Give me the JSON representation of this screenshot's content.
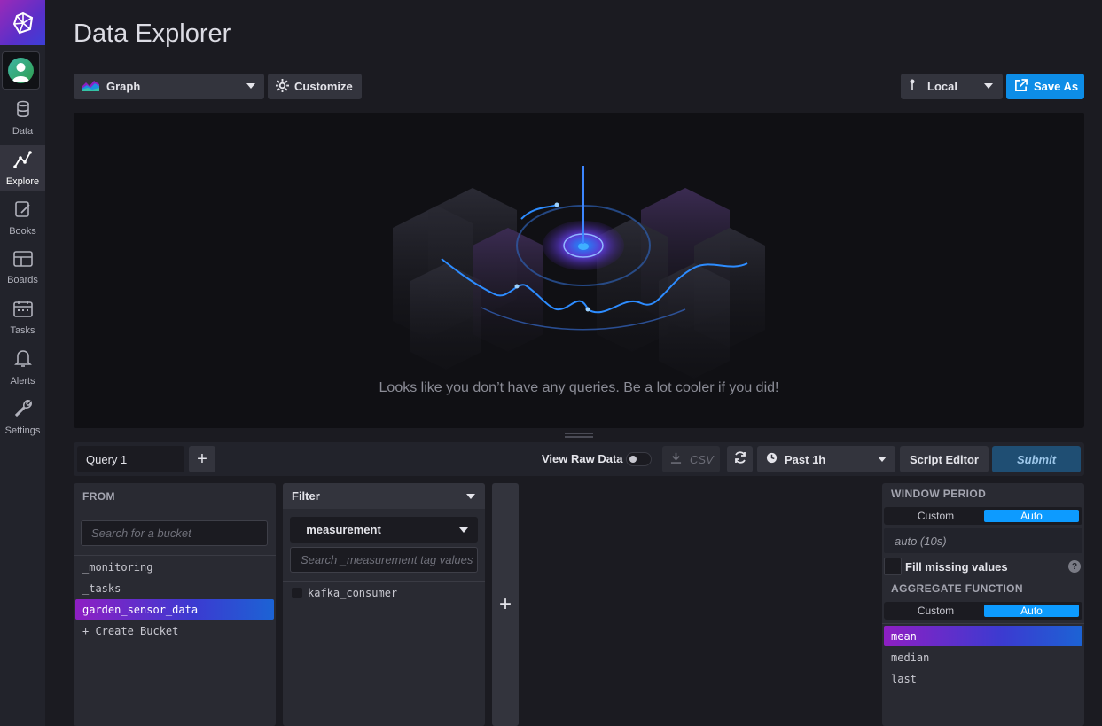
{
  "page": {
    "title": "Data Explorer"
  },
  "sidebar": {
    "items": [
      {
        "label": "Data",
        "icon": "database-icon"
      },
      {
        "label": "Explore",
        "icon": "explore-graph-icon",
        "active": true
      },
      {
        "label": "Books",
        "icon": "notebook-icon"
      },
      {
        "label": "Boards",
        "icon": "dashboard-grid-icon"
      },
      {
        "label": "Tasks",
        "icon": "calendar-icon"
      },
      {
        "label": "Alerts",
        "icon": "bell-icon"
      },
      {
        "label": "Settings",
        "icon": "wrench-icon"
      }
    ]
  },
  "toolbar": {
    "vis_type": "Graph",
    "customize_label": "Customize",
    "timezone": "Local",
    "save_as_label": "Save As"
  },
  "graph": {
    "empty_message": "Looks like you don’t have any queries. Be a lot cooler if you did!"
  },
  "query_bar": {
    "tab_label": "Query 1",
    "add_tab_label": "+",
    "view_raw_label": "View Raw Data",
    "csv_label": "CSV",
    "time_range": "Past 1h",
    "script_editor_label": "Script Editor",
    "submit_label": "Submit"
  },
  "from_panel": {
    "title": "FROM",
    "search_placeholder": "Search for a bucket",
    "buckets": [
      "_monitoring",
      "_tasks",
      "garden_sensor_data"
    ],
    "selected_bucket": "garden_sensor_data",
    "create_label": "+ Create Bucket"
  },
  "filter_panel": {
    "title": "Filter",
    "key": "_measurement",
    "search_placeholder": "Search _measurement tag values",
    "values": [
      "kafka_consumer"
    ]
  },
  "add_filter": {
    "label": "+"
  },
  "window_period": {
    "title": "WINDOW PERIOD",
    "custom_label": "Custom",
    "auto_label": "Auto",
    "value": "auto (10s)",
    "fill_missing_label": "Fill missing values",
    "help_label": "?"
  },
  "aggregate": {
    "title": "AGGREGATE FUNCTION",
    "custom_label": "Custom",
    "auto_label": "Auto",
    "functions": [
      "mean",
      "median",
      "last"
    ],
    "selected": "mean"
  },
  "colors": {
    "accent_blue": "#0d8de7",
    "auto_toggle": "#0d9bff",
    "selection_gradient_start": "#8e1fc3",
    "selection_gradient_end": "#1c63d4"
  }
}
